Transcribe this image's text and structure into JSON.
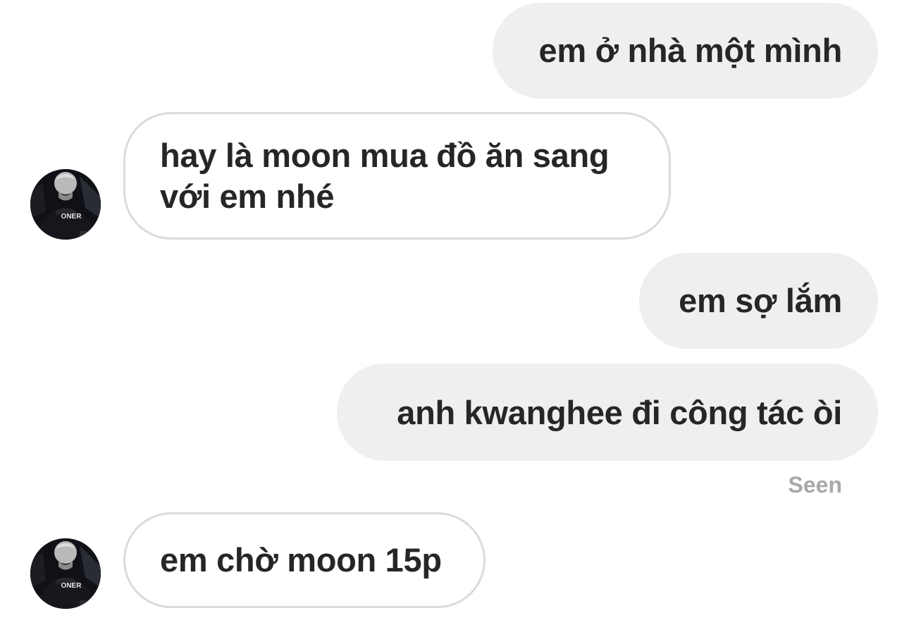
{
  "conversation": {
    "messages": [
      {
        "direction": "outgoing",
        "text": "em ở nhà một mình"
      },
      {
        "direction": "incoming",
        "text": "hay là moon mua đồ ăn sang với em nhé"
      },
      {
        "direction": "outgoing",
        "text": "em sợ lắm"
      },
      {
        "direction": "outgoing",
        "text": "anh kwanghee đi công tác òi"
      },
      {
        "direction": "incoming",
        "text": "em chờ moon 15p"
      }
    ],
    "read_receipt": "Seen"
  },
  "avatar": {
    "jersey_text": "ONER"
  },
  "colors": {
    "outgoing_bubble": "#efefef",
    "incoming_border": "#dbdbdb",
    "text": "#262626",
    "seen_text": "#a8a8a8",
    "background": "#ffffff"
  }
}
